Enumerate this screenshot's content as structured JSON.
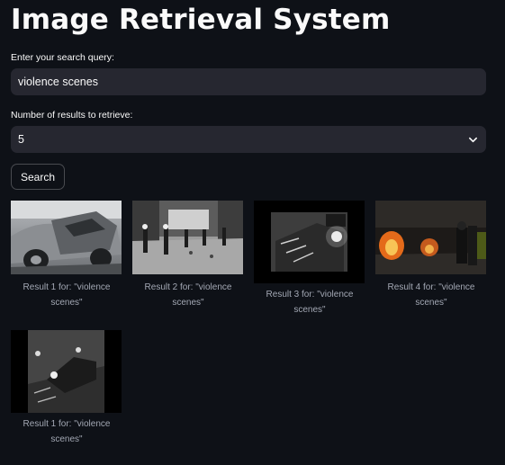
{
  "page": {
    "title": "Image Retrieval System"
  },
  "search": {
    "label": "Enter your search query:",
    "value": "violence scenes"
  },
  "num_results": {
    "label": "Number of results to retrieve:",
    "selected": "5"
  },
  "button": {
    "label": "Search"
  },
  "results": [
    {
      "caption": "Result 1 for: \"violence scenes\"",
      "icon": "car-crash-image"
    },
    {
      "caption": "Result 2 for: \"violence scenes\"",
      "icon": "street-riot-image"
    },
    {
      "caption": "Result 3 for: \"violence scenes\"",
      "icon": "cctv-night-image"
    },
    {
      "caption": "Result 4 for: \"violence scenes\"",
      "icon": "fire-protest-image"
    },
    {
      "caption": "Result 1 for: \"violence scenes\"",
      "icon": "cctv-car-image"
    }
  ]
}
